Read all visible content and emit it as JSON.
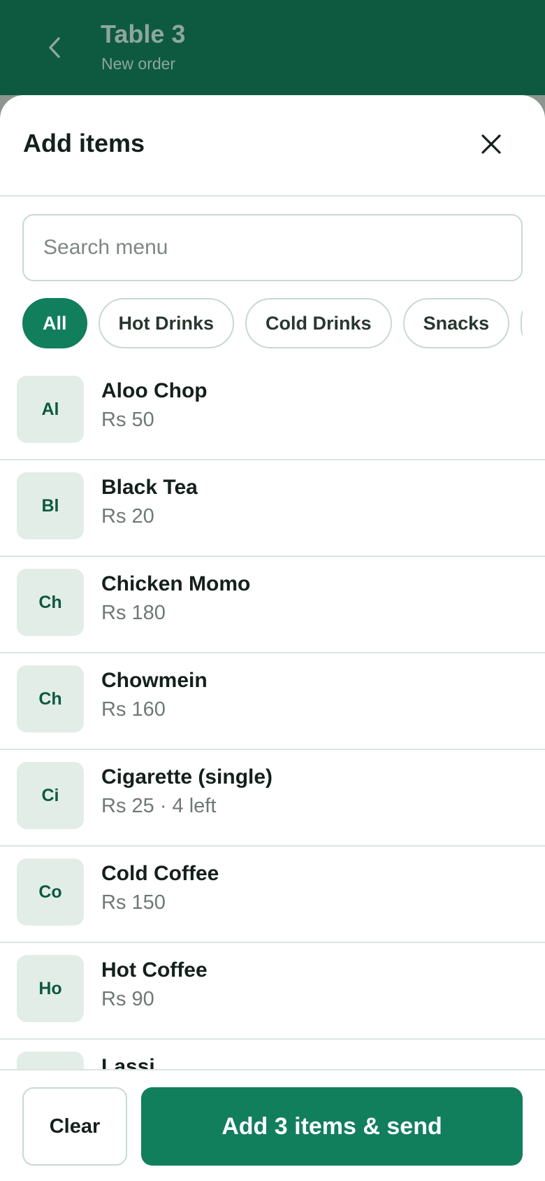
{
  "colors": {
    "primary": "#117e5c",
    "header": "#0d5a41",
    "avatar_bg": "#e3ede8",
    "border": "#c9d9d1"
  },
  "topbar": {
    "back_icon": "chevron-left-icon",
    "title": "Table 3",
    "subtitle": "New order"
  },
  "sheet": {
    "title": "Add items",
    "close_icon": "close-icon"
  },
  "search": {
    "placeholder": "Search menu",
    "value": ""
  },
  "categories": [
    {
      "label": "All",
      "active": true
    },
    {
      "label": "Hot Drinks",
      "active": false
    },
    {
      "label": "Cold Drinks",
      "active": false
    },
    {
      "label": "Snacks",
      "active": false
    },
    {
      "label": "",
      "active": false
    }
  ],
  "items": [
    {
      "initials": "Al",
      "name": "Aloo Chop",
      "price": "Rs 50"
    },
    {
      "initials": "Bl",
      "name": "Black Tea",
      "price": "Rs 20"
    },
    {
      "initials": "Ch",
      "name": "Chicken Momo",
      "price": "Rs 180"
    },
    {
      "initials": "Ch",
      "name": "Chowmein",
      "price": "Rs 160"
    },
    {
      "initials": "Ci",
      "name": "Cigarette (single)",
      "price": "Rs 25 · 4 left"
    },
    {
      "initials": "Co",
      "name": "Cold Coffee",
      "price": "Rs 150"
    },
    {
      "initials": "Ho",
      "name": "Hot Coffee",
      "price": "Rs 90"
    },
    {
      "initials": "",
      "name": "Lassi",
      "price": ""
    }
  ],
  "footer": {
    "clear_label": "Clear",
    "send_label": "Add 3 items & send"
  }
}
